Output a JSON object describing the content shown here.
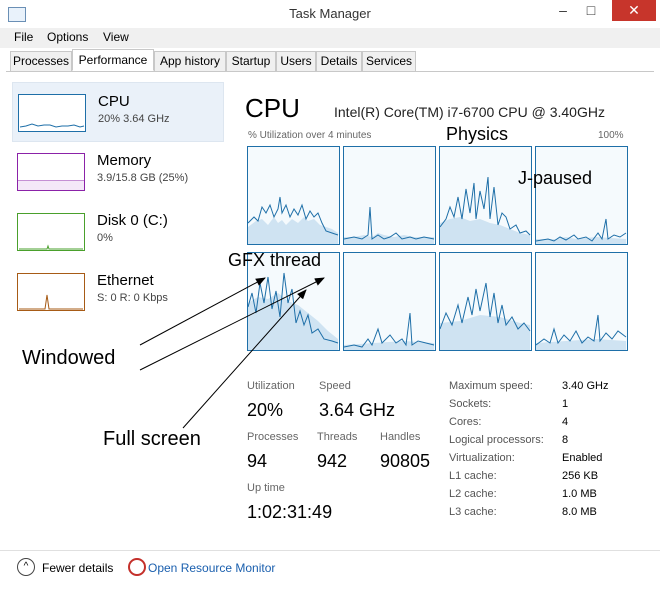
{
  "window": {
    "title": "Task Manager",
    "minimize": "–",
    "maximize": "□",
    "close": "✕"
  },
  "menu": [
    "File",
    "Options",
    "View"
  ],
  "tabs": [
    "Processes",
    "Performance",
    "App history",
    "Startup",
    "Users",
    "Details",
    "Services"
  ],
  "resources": [
    {
      "name": "CPU",
      "detail": "20%  3.64 GHz",
      "color": "#1e6fa8"
    },
    {
      "name": "Memory",
      "detail": "3.9/15.8 GB (25%)",
      "color": "#8b22a8"
    },
    {
      "name": "Disk 0 (C:)",
      "detail": "0%",
      "color": "#4aa02c"
    },
    {
      "name": "Ethernet",
      "detail": "S: 0  R: 0 Kbps",
      "color": "#a75b16"
    }
  ],
  "cpu": {
    "heading": "CPU",
    "model": "Intel(R) Core(TM) i7-6700 CPU @ 3.40GHz",
    "util_label": "% Utilization over 4 minutes",
    "util_max": "100%",
    "stats": {
      "utilization_label": "Utilization",
      "utilization": "20%",
      "speed_label": "Speed",
      "speed": "3.64 GHz",
      "processes_label": "Processes",
      "processes": "94",
      "threads_label": "Threads",
      "threads": "942",
      "handles_label": "Handles",
      "handles": "90805",
      "uptime_label": "Up time",
      "uptime": "1:02:31:49"
    },
    "specs": [
      {
        "label": "Maximum speed:",
        "value": "3.40 GHz"
      },
      {
        "label": "Sockets:",
        "value": "1"
      },
      {
        "label": "Cores:",
        "value": "4"
      },
      {
        "label": "Logical processors:",
        "value": "8"
      },
      {
        "label": "Virtualization:",
        "value": "Enabled"
      },
      {
        "label": "L1 cache:",
        "value": "256 KB"
      },
      {
        "label": "L2 cache:",
        "value": "1.0 MB"
      },
      {
        "label": "L3 cache:",
        "value": "8.0 MB"
      }
    ]
  },
  "annotations": {
    "physics": "Physics",
    "j_paused": "J-paused",
    "gfx_thread": "GFX thread",
    "windowed": "Windowed",
    "full_screen": "Full screen"
  },
  "footer": {
    "fewer_details": "Fewer details",
    "resource_monitor": "Open Resource Monitor"
  },
  "colors": {
    "accent": "#1e6fa8",
    "close": "#c7352b",
    "link": "#1a5fae"
  }
}
